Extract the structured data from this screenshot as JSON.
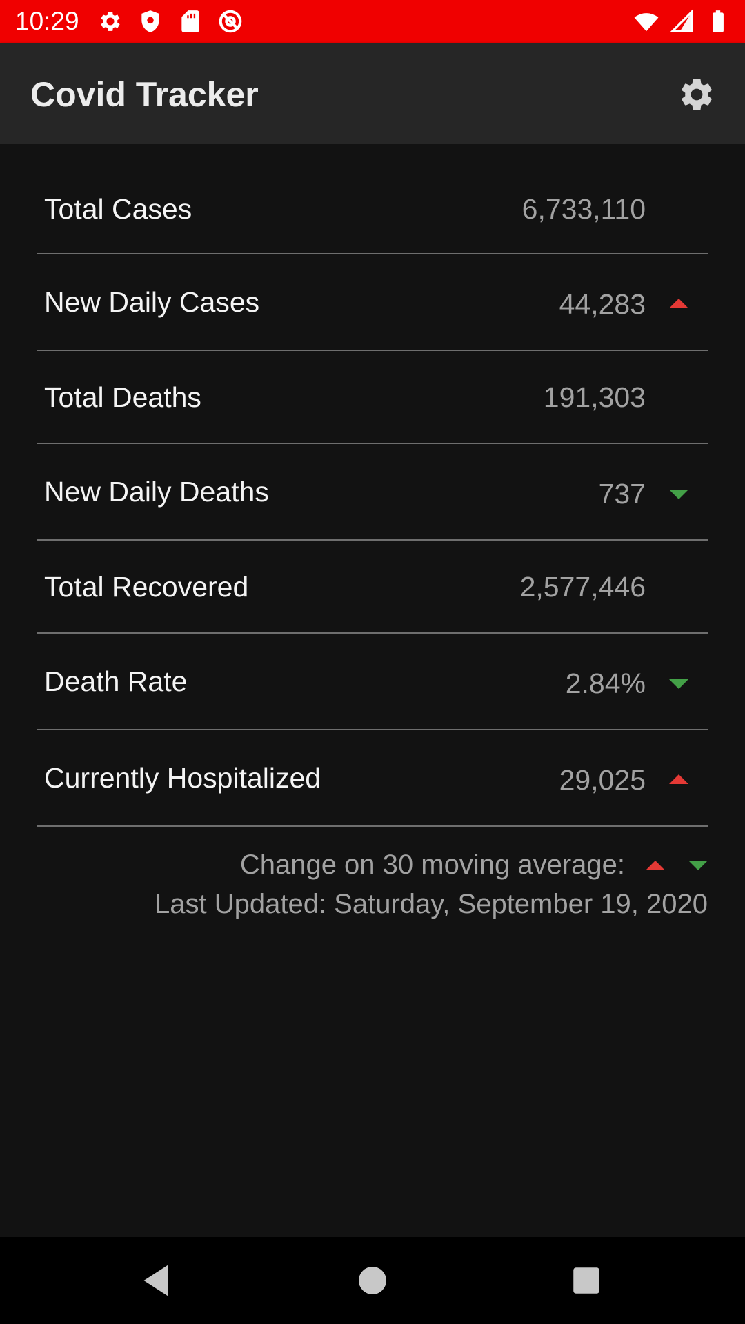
{
  "status_bar": {
    "time": "10:29",
    "left_icons": [
      "gear-icon",
      "shield-icon",
      "sd-card-icon",
      "at-sign-icon"
    ],
    "right_icons": [
      "wifi-icon",
      "cell-signal-icon",
      "battery-icon"
    ],
    "background": "#f00000"
  },
  "app_bar": {
    "title": "Covid Tracker",
    "settings_icon": "settings-gear-icon"
  },
  "stats": [
    {
      "label": "Total Cases",
      "value": "6,733,110",
      "trend": null
    },
    {
      "label": "New Daily Cases",
      "value": "44,283",
      "trend": "up"
    },
    {
      "label": "Total Deaths",
      "value": "191,303",
      "trend": null
    },
    {
      "label": "New Daily Deaths",
      "value": "737",
      "trend": "down"
    },
    {
      "label": "Total Recovered",
      "value": "2,577,446",
      "trend": null
    },
    {
      "label": "Death Rate",
      "value": "2.84%",
      "trend": "down"
    },
    {
      "label": "Currently Hospitalized",
      "value": "29,025",
      "trend": "up"
    }
  ],
  "legend": {
    "text": "Change on 30 moving average:",
    "up_color": "#e53935",
    "down_color": "#43a047"
  },
  "last_updated": "Last Updated: Saturday, September 19, 2020",
  "nav_bar": {
    "buttons": [
      "back-icon",
      "home-icon",
      "recents-icon"
    ]
  }
}
